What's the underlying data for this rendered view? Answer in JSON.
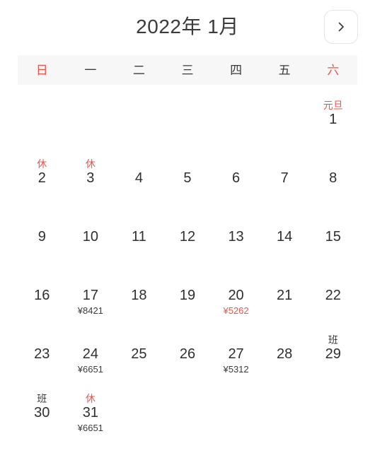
{
  "header": {
    "title": "2022年 1月",
    "next_button_icon": "chevron-right-icon"
  },
  "weekdays": [
    {
      "label": "日",
      "weekend": true
    },
    {
      "label": "一",
      "weekend": false
    },
    {
      "label": "二",
      "weekend": false
    },
    {
      "label": "三",
      "weekend": false
    },
    {
      "label": "四",
      "weekend": false
    },
    {
      "label": "五",
      "weekend": false
    },
    {
      "label": "六",
      "weekend": true
    }
  ],
  "colors": {
    "accent_red": "#e8564b",
    "text_dark": "#2f2f31",
    "weekday_bar_bg": "#f7f7f7",
    "page_bg": "#ffffff",
    "button_border": "#e4e4e6"
  },
  "leading_blanks": 6,
  "days": [
    {
      "number": "1",
      "tag": "元旦",
      "tag_type": "holiday",
      "price": "",
      "price_red": false,
      "number_red": false
    },
    {
      "number": "2",
      "tag": "休",
      "tag_type": "rest",
      "price": "",
      "price_red": false,
      "number_red": false
    },
    {
      "number": "3",
      "tag": "休",
      "tag_type": "rest",
      "price": "",
      "price_red": false,
      "number_red": false
    },
    {
      "number": "4",
      "tag": "",
      "tag_type": "",
      "price": "",
      "price_red": false,
      "number_red": false
    },
    {
      "number": "5",
      "tag": "",
      "tag_type": "",
      "price": "",
      "price_red": false,
      "number_red": false
    },
    {
      "number": "6",
      "tag": "",
      "tag_type": "",
      "price": "",
      "price_red": false,
      "number_red": false
    },
    {
      "number": "7",
      "tag": "",
      "tag_type": "",
      "price": "",
      "price_red": false,
      "number_red": false
    },
    {
      "number": "8",
      "tag": "",
      "tag_type": "",
      "price": "",
      "price_red": false,
      "number_red": false
    },
    {
      "number": "9",
      "tag": "",
      "tag_type": "",
      "price": "",
      "price_red": false,
      "number_red": false
    },
    {
      "number": "10",
      "tag": "",
      "tag_type": "",
      "price": "",
      "price_red": false,
      "number_red": false
    },
    {
      "number": "11",
      "tag": "",
      "tag_type": "",
      "price": "",
      "price_red": false,
      "number_red": false
    },
    {
      "number": "12",
      "tag": "",
      "tag_type": "",
      "price": "",
      "price_red": false,
      "number_red": false
    },
    {
      "number": "13",
      "tag": "",
      "tag_type": "",
      "price": "",
      "price_red": false,
      "number_red": false
    },
    {
      "number": "14",
      "tag": "",
      "tag_type": "",
      "price": "",
      "price_red": false,
      "number_red": false
    },
    {
      "number": "15",
      "tag": "",
      "tag_type": "",
      "price": "",
      "price_red": false,
      "number_red": false
    },
    {
      "number": "16",
      "tag": "",
      "tag_type": "",
      "price": "",
      "price_red": false,
      "number_red": false
    },
    {
      "number": "17",
      "tag": "",
      "tag_type": "",
      "price": "¥8421",
      "price_red": false,
      "number_red": false
    },
    {
      "number": "18",
      "tag": "",
      "tag_type": "",
      "price": "",
      "price_red": false,
      "number_red": false
    },
    {
      "number": "19",
      "tag": "",
      "tag_type": "",
      "price": "",
      "price_red": false,
      "number_red": false
    },
    {
      "number": "20",
      "tag": "",
      "tag_type": "",
      "price": "¥5262",
      "price_red": true,
      "number_red": false
    },
    {
      "number": "21",
      "tag": "",
      "tag_type": "",
      "price": "",
      "price_red": false,
      "number_red": false
    },
    {
      "number": "22",
      "tag": "",
      "tag_type": "",
      "price": "",
      "price_red": false,
      "number_red": false
    },
    {
      "number": "23",
      "tag": "",
      "tag_type": "",
      "price": "",
      "price_red": false,
      "number_red": false
    },
    {
      "number": "24",
      "tag": "",
      "tag_type": "",
      "price": "¥6651",
      "price_red": false,
      "number_red": false
    },
    {
      "number": "25",
      "tag": "",
      "tag_type": "",
      "price": "",
      "price_red": false,
      "number_red": false
    },
    {
      "number": "26",
      "tag": "",
      "tag_type": "",
      "price": "",
      "price_red": false,
      "number_red": false
    },
    {
      "number": "27",
      "tag": "",
      "tag_type": "",
      "price": "¥5312",
      "price_red": false,
      "number_red": false
    },
    {
      "number": "28",
      "tag": "",
      "tag_type": "",
      "price": "",
      "price_red": false,
      "number_red": false
    },
    {
      "number": "29",
      "tag": "班",
      "tag_type": "work",
      "price": "",
      "price_red": false,
      "number_red": false
    },
    {
      "number": "30",
      "tag": "班",
      "tag_type": "work",
      "price": "",
      "price_red": false,
      "number_red": false
    },
    {
      "number": "31",
      "tag": "休",
      "tag_type": "rest",
      "price": "¥6651",
      "price_red": false,
      "number_red": false
    }
  ]
}
